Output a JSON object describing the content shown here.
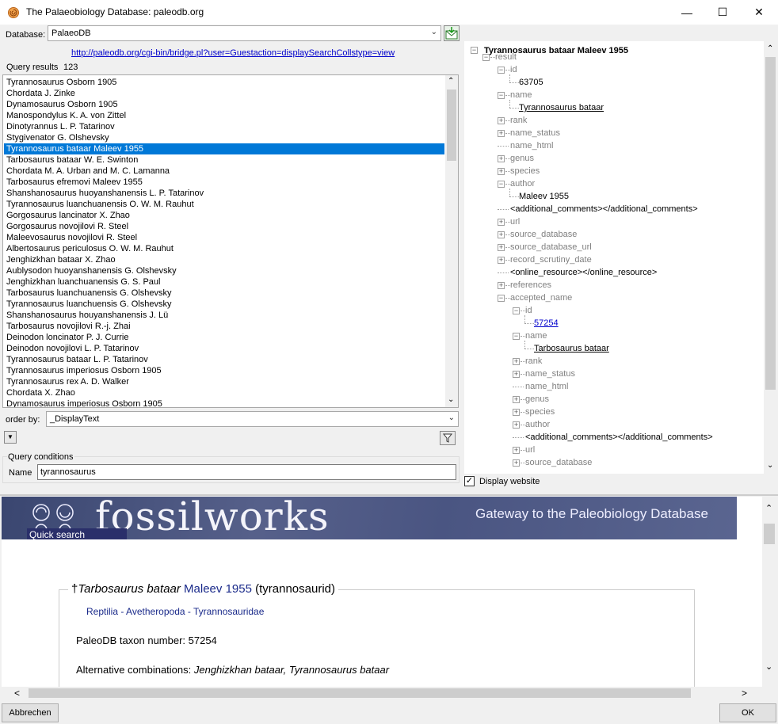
{
  "window": {
    "title": "The Palaeobiology Database: paleodb.org"
  },
  "database": {
    "label": "Database:",
    "value": "PalaeoDB"
  },
  "url": "http://paleodb.org/cgi-bin/bridge.pl?user=Guestaction=displaySearchCollstype=view",
  "query_results": {
    "label": "Query results",
    "count": "123"
  },
  "results": [
    "Tyrannosaurus Osborn 1905",
    "Chordata J. Zinke",
    "Dynamosaurus Osborn 1905",
    "Manospondylus K. A. von Zittel",
    "Dinotyrannus L. P. Tatarinov",
    "Stygivenator G. Olshevsky",
    "Tyrannosaurus bataar Maleev 1955",
    "Tarbosaurus bataar W. E. Swinton",
    "Chordata M. A. Urban and M. C. Lamanna",
    "Tarbosaurus efremovi Maleev 1955",
    "Shanshanosaurus huoyanshanensis L. P. Tatarinov",
    "Tyrannosaurus luanchuanensis O. W. M. Rauhut",
    "Gorgosaurus lancinator X. Zhao",
    "Gorgosaurus novojilovi R. Steel",
    "Maleevosaurus novojilovi R. Steel",
    "Albertosaurus periculosus O. W. M. Rauhut",
    "Jenghizkhan bataar X. Zhao",
    "Aublysodon huoyanshanensis G. Olshevsky",
    "Jenghizkhan luanchuanensis G. S. Paul",
    "Tarbosaurus luanchuanensis G. Olshevsky",
    "Tyrannosaurus luanchuensis G. Olshevsky",
    "Shanshanosaurus houyanshanensis J. Lü",
    "Tarbosaurus novojilovi R.-j. Zhai",
    "Deinodon loncinator P. J. Currie",
    "Deinodon novojilovi L. P. Tatarinov",
    "Tyrannosaurus bataar L. P. Tatarinov",
    "Tyrannosaurus imperiosus Osborn 1905",
    "Tyrannosaurus rex A. D. Walker",
    "Chordata X. Zhao",
    "Dynamosaurus imperiosus Osborn 1905"
  ],
  "selected_index": 6,
  "order_by": {
    "label": "order by:",
    "value": "_DisplayText"
  },
  "query_conditions": {
    "label": "Query conditions",
    "name_label": "Name",
    "name_value": "tyrannosaurus"
  },
  "tree": {
    "root": "Tyrannosaurus bataar Maleev 1955",
    "nodes": [
      {
        "label": "result"
      },
      {
        "label": "id"
      },
      {
        "label": "63705"
      },
      {
        "label": "name"
      },
      {
        "label": "Tyrannosaurus bataar"
      },
      {
        "label": "rank"
      },
      {
        "label": "name_status"
      },
      {
        "label": "name_html"
      },
      {
        "label": "genus"
      },
      {
        "label": "species"
      },
      {
        "label": "author"
      },
      {
        "label": "Maleev 1955"
      },
      {
        "label": "<additional_comments></additional_comments>"
      },
      {
        "label": "url"
      },
      {
        "label": "source_database"
      },
      {
        "label": "source_database_url"
      },
      {
        "label": "record_scrutiny_date"
      },
      {
        "label": "<online_resource></online_resource>"
      },
      {
        "label": "references"
      },
      {
        "label": "accepted_name"
      },
      {
        "label": "id"
      },
      {
        "label": "57254"
      },
      {
        "label": "name"
      },
      {
        "label": "Tarbosaurus bataar"
      },
      {
        "label": "rank"
      },
      {
        "label": "name_status"
      },
      {
        "label": "name_html"
      },
      {
        "label": "genus"
      },
      {
        "label": "species"
      },
      {
        "label": "author"
      },
      {
        "label": "<additional_comments></additional_comments>"
      },
      {
        "label": "url"
      },
      {
        "label": "source_database"
      }
    ]
  },
  "display_website": {
    "label": "Display website",
    "checked": true
  },
  "website": {
    "logo": "fossilworks",
    "tagline": "Gateway to the Paleobiology Database",
    "quick_search": "Quick search",
    "taxon": {
      "dagger": "†",
      "name": "Tarbosaurus bataar",
      "author": "Maleev 1955",
      "common": "(tyrannosaurid)",
      "class": "Reptilia",
      "order": "Avetheropoda",
      "family": "Tyrannosauridae",
      "sep": " - ",
      "number_label": "PaleoDB taxon number: 57254",
      "alt_label": "Alternative combinations: ",
      "alt_values": "Jenghizkhan bataar, Tyrannosaurus bataar"
    }
  },
  "buttons": {
    "cancel": "Abbrechen",
    "ok": "OK"
  },
  "icons": {
    "app": "ammonite-icon",
    "minimize": "—",
    "maximize": "☐",
    "close": "✕",
    "down": "▼",
    "filter": "filter-icon"
  }
}
